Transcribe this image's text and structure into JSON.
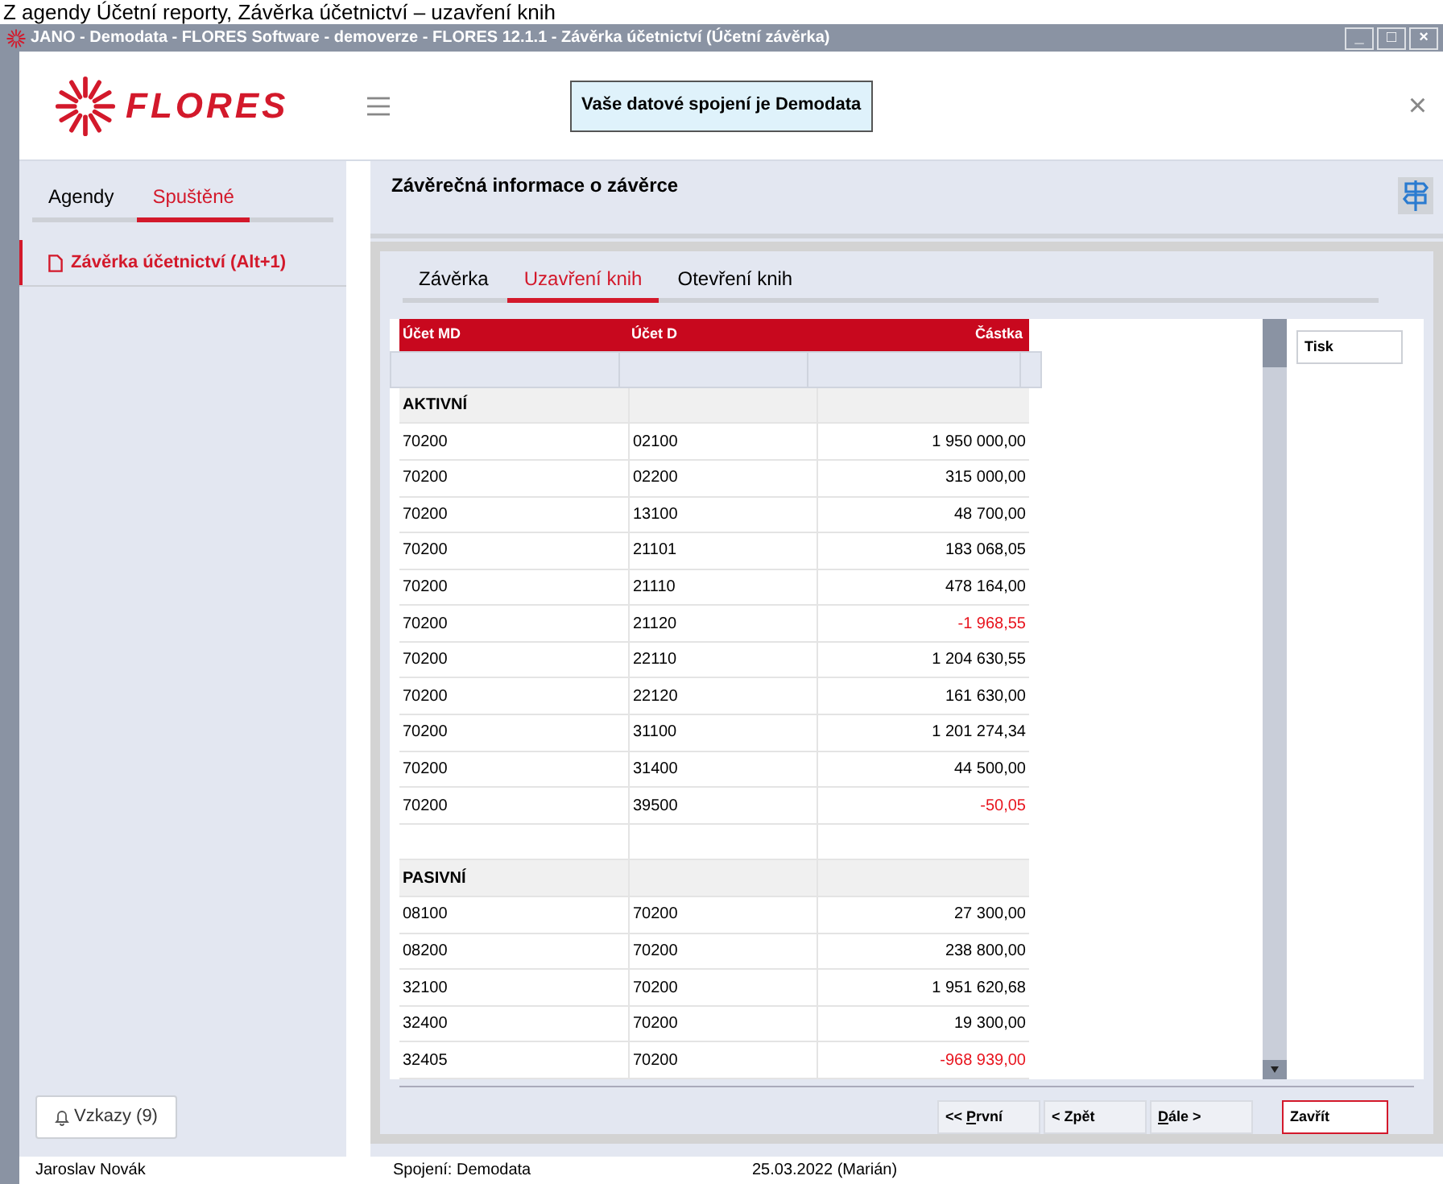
{
  "caption": "Z agendy Účetní reporty, Závěrka účetnictví – uzavření knih",
  "window": {
    "title": "JANO - Demodata - FLORES Software - demoverze - FLORES 12.1.1 - Závěrka účetnictví  (Účetní závěrka)",
    "controls": [
      "_",
      "□",
      "×"
    ]
  },
  "header": {
    "logo": "FLORES",
    "notice": "Vaše datové spojení je Demodata",
    "close": "×"
  },
  "sidebar": {
    "tabs": [
      {
        "label": "Agendy",
        "selected": false
      },
      {
        "label": "Spuštěné",
        "selected": true
      }
    ],
    "items": [
      {
        "label": "Závěrka účetnictví (Alt+1)",
        "selected": true
      }
    ],
    "messages_button": "Vzkazy (9)"
  },
  "page_title": "Závěrečná informace o závěrce",
  "tabs": [
    {
      "label": "Závěrka",
      "selected": false
    },
    {
      "label": "Uzavření knih",
      "selected": true
    },
    {
      "label": "Otevření knih",
      "selected": false
    }
  ],
  "table": {
    "columns": [
      "Účet MD",
      "Účet D",
      "Částka"
    ],
    "rows": [
      {
        "kind": "section",
        "label": "AKTIVNÍ"
      },
      {
        "kind": "data",
        "md": "70200",
        "d": "02100",
        "amount": "1 950 000,00",
        "negative": false
      },
      {
        "kind": "data",
        "md": "70200",
        "d": "02200",
        "amount": "315 000,00",
        "negative": false
      },
      {
        "kind": "data",
        "md": "70200",
        "d": "13100",
        "amount": "48 700,00",
        "negative": false
      },
      {
        "kind": "data",
        "md": "70200",
        "d": "21101",
        "amount": "183 068,05",
        "negative": false
      },
      {
        "kind": "data",
        "md": "70200",
        "d": "21110",
        "amount": "478 164,00",
        "negative": false
      },
      {
        "kind": "data",
        "md": "70200",
        "d": "21120",
        "amount": "-1 968,55",
        "negative": true
      },
      {
        "kind": "data",
        "md": "70200",
        "d": "22110",
        "amount": "1 204 630,55",
        "negative": false
      },
      {
        "kind": "data",
        "md": "70200",
        "d": "22120",
        "amount": "161 630,00",
        "negative": false
      },
      {
        "kind": "data",
        "md": "70200",
        "d": "31100",
        "amount": "1 201 274,34",
        "negative": false
      },
      {
        "kind": "data",
        "md": "70200",
        "d": "31400",
        "amount": "44 500,00",
        "negative": false
      },
      {
        "kind": "data",
        "md": "70200",
        "d": "39500",
        "amount": "-50,05",
        "negative": true
      },
      {
        "kind": "blank"
      },
      {
        "kind": "section",
        "label": "PASIVNÍ"
      },
      {
        "kind": "data",
        "md": "08100",
        "d": "70200",
        "amount": "27 300,00",
        "negative": false
      },
      {
        "kind": "data",
        "md": "08200",
        "d": "70200",
        "amount": "238 800,00",
        "negative": false
      },
      {
        "kind": "data",
        "md": "32100",
        "d": "70200",
        "amount": "1 951 620,68",
        "negative": false
      },
      {
        "kind": "data",
        "md": "32400",
        "d": "70200",
        "amount": "19 300,00",
        "negative": false
      },
      {
        "kind": "data",
        "md": "32405",
        "d": "70200",
        "amount": "-968 939,00",
        "negative": true
      }
    ]
  },
  "side_buttons": [
    "Tisk"
  ],
  "nav_buttons": [
    "<< **P**rvní",
    "< Zpět",
    "**D**ále >"
  ],
  "close_button": "Zavřít",
  "status_bar": {
    "user": "Jaroslav Novák",
    "connection": "Spojení: Demodata",
    "date": "25.03.2022 (Marián)"
  }
}
